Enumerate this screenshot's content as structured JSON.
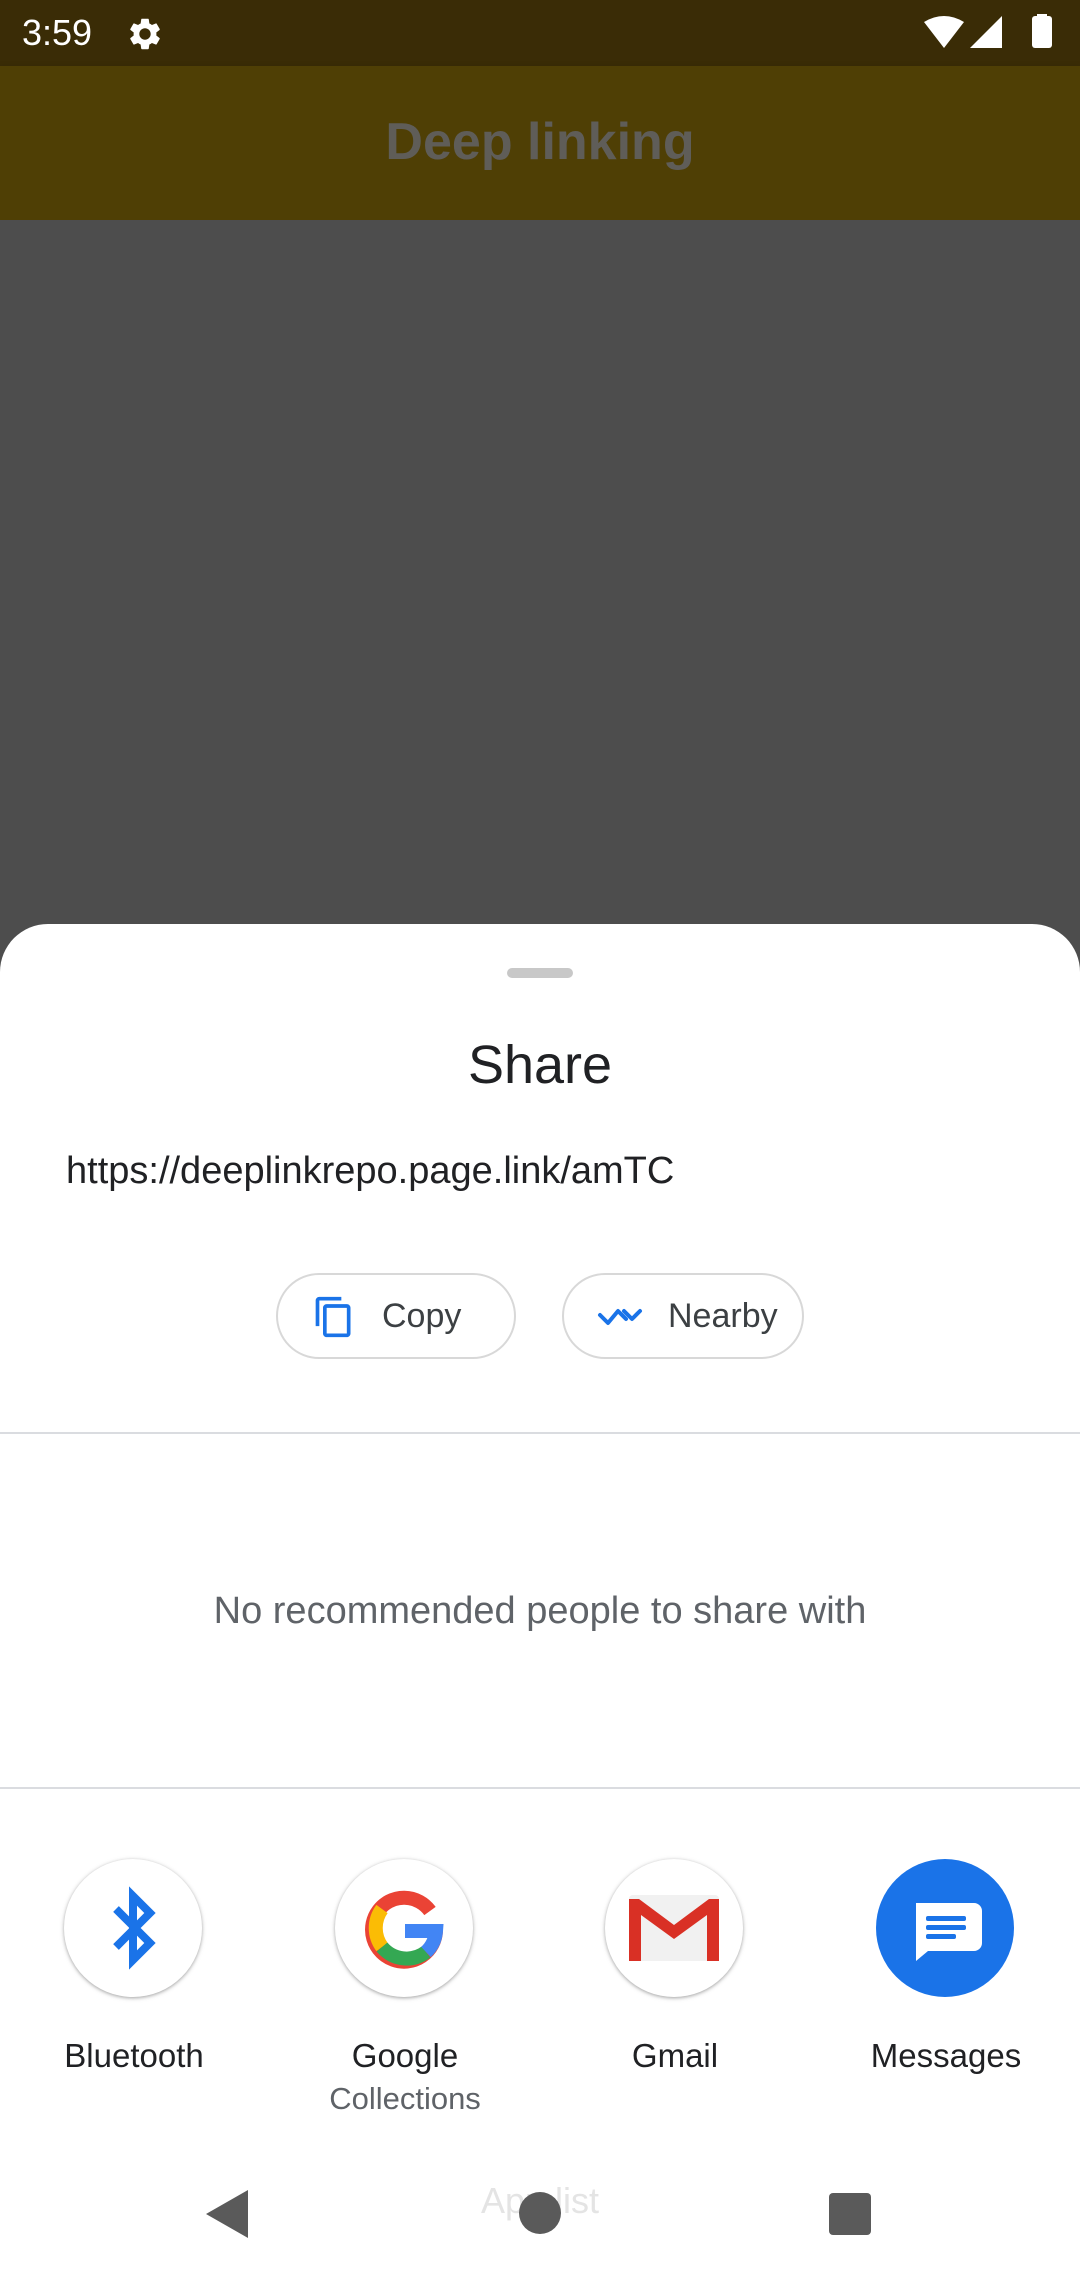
{
  "status_bar": {
    "time": "3:59",
    "icons": [
      "gear-icon",
      "wifi-icon",
      "signal-icon",
      "battery-icon"
    ]
  },
  "app_bar": {
    "title": "Deep linking"
  },
  "share_sheet": {
    "title": "Share",
    "url": "https://deeplinkrepo.page.link/amTC",
    "actions": [
      {
        "label": "Copy",
        "icon": "copy-icon"
      },
      {
        "label": "Nearby",
        "icon": "nearby-icon"
      }
    ],
    "people_message": "No recommended people to share with",
    "targets": [
      {
        "label": "Bluetooth",
        "sublabel": "",
        "icon": "bluetooth-icon"
      },
      {
        "label": "Google",
        "sublabel": "Collections",
        "icon": "google-icon"
      },
      {
        "label": "Gmail",
        "sublabel": "",
        "icon": "gmail-icon"
      },
      {
        "label": "Messages",
        "sublabel": "",
        "icon": "messages-icon"
      }
    ],
    "obscured_label": "App list"
  },
  "nav_bar": {
    "icons": [
      "back-icon",
      "home-icon",
      "recents-icon"
    ]
  },
  "colors": {
    "accent": "#1a73e8",
    "status_bar": "#3a2c06",
    "app_bar": "#4f3f05",
    "scrim": "#4d4d4d"
  }
}
